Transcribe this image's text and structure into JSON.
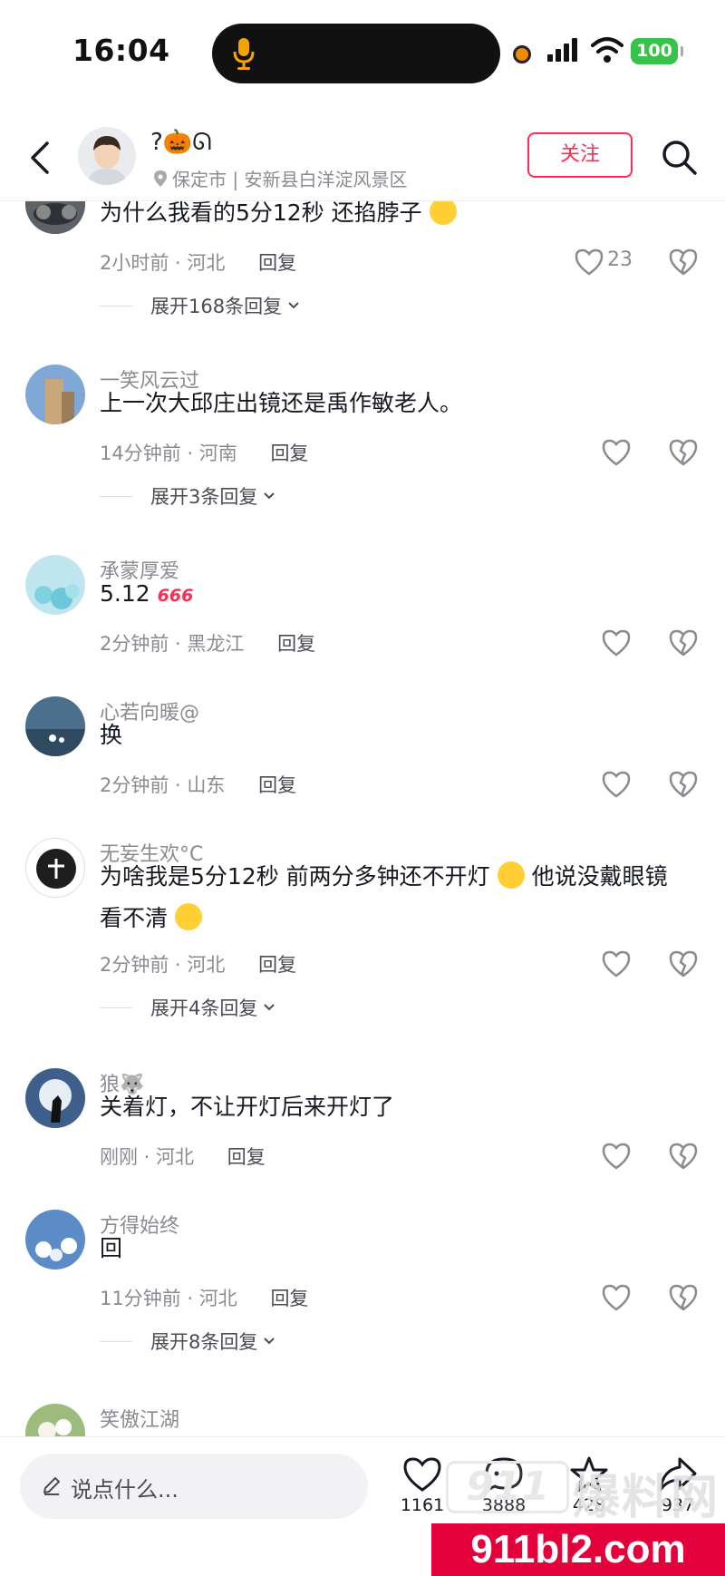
{
  "status_bar": {
    "time": "16:04",
    "battery": "100",
    "icons": [
      "microphone-icon",
      "recording-dot-icon",
      "signal-icon",
      "wifi-icon",
      "battery-icon"
    ]
  },
  "header": {
    "user_name": "?🎃ᘏ",
    "location": "保定市 | 安新县白洋淀风景区",
    "follow_label": "关注"
  },
  "comments": [
    {
      "name": "",
      "text": "为什么我看的5分12秒 还掐脖子",
      "emoji": "😜",
      "time": "2小时前 · 河北",
      "reply": "回复",
      "likes": "23",
      "expand": "展开168条回复"
    },
    {
      "name": "一笑风云过",
      "text": "上一次大邱庄出镜还是禹作敏老人。",
      "time": "14分钟前 · 河南",
      "reply": "回复",
      "expand": "展开3条回复"
    },
    {
      "name": "承蒙厚爱",
      "text": "5.12",
      "emoji_text": "666",
      "time": "2分钟前 · 黑龙江",
      "reply": "回复"
    },
    {
      "name": "心若向暖@",
      "text": "换",
      "time": "2分钟前 · 山东",
      "reply": "回复"
    },
    {
      "name": "无妄生欢°C",
      "text_line1": "为啥我是5分12秒 前两分多钟还不开灯",
      "text_line1b": "他说没戴眼镜",
      "text_line2": "看不清",
      "time": "2分钟前 · 河北",
      "reply": "回复",
      "expand": "展开4条回复"
    },
    {
      "name": "狼🐺",
      "text": "关着灯，不让开灯后来开灯了",
      "time": "刚刚 · 河北",
      "reply": "回复"
    },
    {
      "name": "方得始终",
      "text": "回",
      "time": "11分钟前 · 河北",
      "reply": "回复",
      "expand": "展开8条回复"
    },
    {
      "name": "笑傲江湖"
    }
  ],
  "bottom_bar": {
    "input_placeholder": "说点什么...",
    "like_count": "1161",
    "comment_count": "3888",
    "star_count": "428",
    "share_count": "937"
  },
  "watermark": {
    "logo_number": "911",
    "logo_text": "爆料网",
    "url": "911bl2.com"
  },
  "colors": {
    "accent": "#fe2c55",
    "meta_text": "#8a8b91",
    "battery": "#37c24a",
    "watermark_red": "#e4003a"
  }
}
